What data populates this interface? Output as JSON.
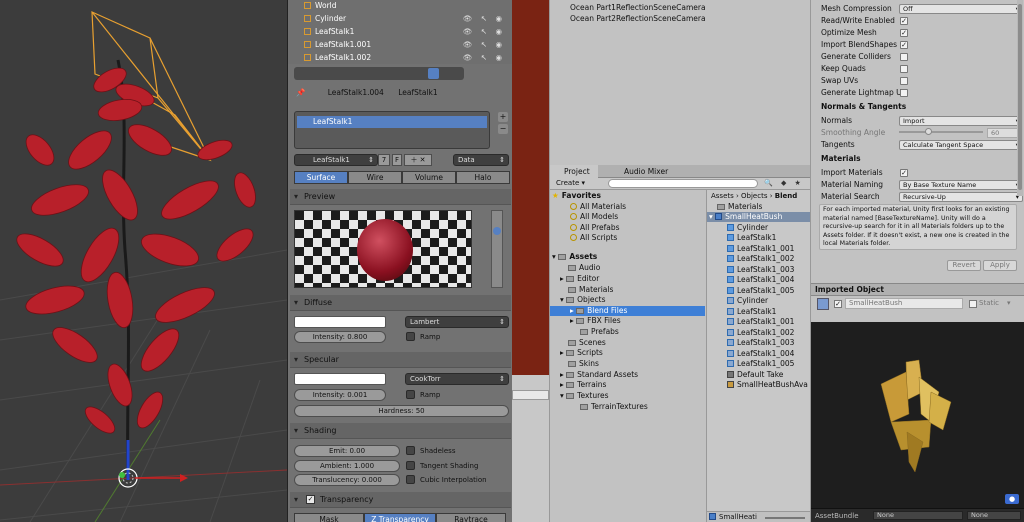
{
  "outliner": {
    "rows": [
      {
        "label": "World"
      },
      {
        "label": "Cylinder"
      },
      {
        "label": "LeafStalk1"
      },
      {
        "label": "LeafStalk1.001"
      },
      {
        "label": "LeafStalk1.002"
      }
    ]
  },
  "material_panel": {
    "breadcrumb": [
      "LeafStalk1.004",
      "LeafStalk1"
    ],
    "slot_name": "LeafStalk1",
    "material_name": "LeafStalk1",
    "users": "7",
    "fake_user": "F",
    "link_type": "Data",
    "tabs": [
      "Surface",
      "Wire",
      "Volume",
      "Halo"
    ],
    "preview_header": "Preview",
    "diffuse": {
      "header": "Diffuse",
      "shader": "Lambert",
      "intensity": "Intensity: 0.800",
      "ramp": "Ramp"
    },
    "specular": {
      "header": "Specular",
      "shader": "CookTorr",
      "intensity": "Intensity: 0.001",
      "ramp": "Ramp",
      "hardness": "Hardness: 50"
    },
    "shading": {
      "header": "Shading",
      "emit": "Emit: 0.00",
      "ambient": "Ambient: 1.000",
      "translucency": "Translucency: 0.000",
      "shadeless": "Shadeless",
      "tangent": "Tangent Shading",
      "cubic": "Cubic Interpolation"
    },
    "transparency": {
      "header": "Transparency",
      "modes": [
        "Mask",
        "Z Transparency",
        "Raytrace"
      ]
    }
  },
  "hierarchy": {
    "items": [
      "Ocean Part1ReflectionSceneCamera",
      "Ocean Part2ReflectionSceneCamera"
    ]
  },
  "project": {
    "tabs": [
      "Project",
      "Audio Mixer"
    ],
    "create_label": "Create",
    "favorites_header": "Favorites",
    "favorites": [
      "All Materials",
      "All Models",
      "All Prefabs",
      "All Scripts"
    ],
    "assets_header": "Assets",
    "asset_folders": [
      "Audio",
      "Editor",
      "Materials",
      "Objects",
      "Blend Files",
      "FBX Files",
      "Prefabs",
      "Scenes",
      "Scripts",
      "Skins",
      "Standard Assets",
      "Terrains",
      "Textures",
      "TerrainTextures"
    ],
    "breadcrumb": [
      "Assets",
      "Objects",
      "Blend"
    ],
    "files": [
      {
        "label": "Materials",
        "icon": "folder-icon"
      },
      {
        "label": "SmallHeatBush",
        "icon": "prefab-icon"
      },
      {
        "label": "Cylinder",
        "icon": "mesh-icon"
      },
      {
        "label": "LeafStalk1",
        "icon": "mesh-icon"
      },
      {
        "label": "LeafStalk1_001",
        "icon": "mesh-icon"
      },
      {
        "label": "LeafStalk1_002",
        "icon": "mesh-icon"
      },
      {
        "label": "LeafStalk1_003",
        "icon": "mesh-icon"
      },
      {
        "label": "LeafStalk1_004",
        "icon": "mesh-icon"
      },
      {
        "label": "LeafStalk1_005",
        "icon": "mesh-icon"
      },
      {
        "label": "Cylinder",
        "icon": "grid-mesh-icon"
      },
      {
        "label": "LeafStalk1",
        "icon": "grid-mesh-icon"
      },
      {
        "label": "LeafStalk1_001",
        "icon": "grid-mesh-icon"
      },
      {
        "label": "LeafStalk1_002",
        "icon": "grid-mesh-icon"
      },
      {
        "label": "LeafStalk1_003",
        "icon": "grid-mesh-icon"
      },
      {
        "label": "LeafStalk1_004",
        "icon": "grid-mesh-icon"
      },
      {
        "label": "LeafStalk1_005",
        "icon": "grid-mesh-icon"
      },
      {
        "label": "Default Take",
        "icon": "animation-icon"
      },
      {
        "label": "SmallHeatBushAva",
        "icon": "avatar-icon"
      }
    ],
    "footer_label": "SmallHeati"
  },
  "inspector": {
    "rows": [
      {
        "label": "Mesh Compression",
        "type": "dropdown",
        "value": "Off"
      },
      {
        "label": "Read/Write Enabled",
        "type": "check",
        "checked": true
      },
      {
        "label": "Optimize Mesh",
        "type": "check",
        "checked": true
      },
      {
        "label": "Import BlendShapes",
        "type": "check",
        "checked": true
      },
      {
        "label": "Generate Colliders",
        "type": "check",
        "checked": false
      },
      {
        "label": "Keep Quads",
        "type": "check",
        "checked": false
      },
      {
        "label": "Swap UVs",
        "type": "check",
        "checked": false
      },
      {
        "label": "Generate Lightmap U",
        "type": "check",
        "checked": false
      }
    ],
    "normals_header": "Normals & Tangents",
    "normals_label": "Normals",
    "normals_value": "Import",
    "smoothing_label": "Smoothing Angle",
    "smoothing_value": "60",
    "tangents_label": "Tangents",
    "tangents_value": "Calculate Tangent Space",
    "materials_header": "Materials",
    "import_materials_label": "Import Materials",
    "material_naming_label": "Material Naming",
    "material_naming_value": "By Base Texture Name",
    "material_search_label": "Material Search",
    "material_search_value": "Recursive-Up",
    "help_text": "For each imported material, Unity first looks for an existing material named [BaseTextureName]. Unity will do a recursive-up search for it in all Materials folders up to the Assets folder. If it doesn't exist, a new one is created in the local Materials folder.",
    "revert_label": "Revert",
    "apply_label": "Apply",
    "imported_object_header": "Imported Object",
    "object_name": "SmallHeatBush",
    "static_label": "Static"
  },
  "preview": {
    "footer_label": "AssetBundle",
    "bundle_value": "None",
    "variant_value": "None"
  },
  "colors": {
    "leaf_red": "#b8202a",
    "selection_orange": "#e8a030",
    "blender_blue": "#5680c2",
    "unity_selection": "#3e7fd6"
  }
}
